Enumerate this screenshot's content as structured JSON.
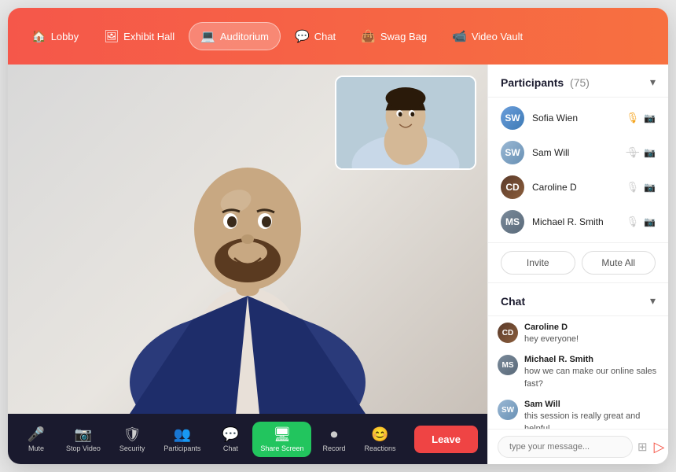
{
  "nav": {
    "items": [
      {
        "id": "lobby",
        "label": "Lobby",
        "icon": "🏠",
        "active": false
      },
      {
        "id": "exhibit-hall",
        "label": "Exhibit Hall",
        "icon": "🖼",
        "active": false
      },
      {
        "id": "auditorium",
        "label": "Auditorium",
        "icon": "💻",
        "active": true
      },
      {
        "id": "chat",
        "label": "Chat",
        "icon": "💬",
        "active": false
      },
      {
        "id": "swag-bag",
        "label": "Swag Bag",
        "icon": "👜",
        "active": false
      },
      {
        "id": "video-vault",
        "label": "Video Vault",
        "icon": "📹",
        "active": false
      }
    ]
  },
  "participants": {
    "title": "Participants",
    "count": "(75)",
    "list": [
      {
        "name": "Sofia Wien",
        "mic": true,
        "cam": true
      },
      {
        "name": "Sam Will",
        "mic": false,
        "cam": false
      },
      {
        "name": "Caroline D",
        "mic": false,
        "cam": false
      },
      {
        "name": "Michael R. Smith",
        "mic": false,
        "cam": false
      }
    ]
  },
  "actions": {
    "invite": "Invite",
    "mute_all": "Mute All"
  },
  "chat": {
    "title": "Chat",
    "messages": [
      {
        "sender": "Caroline D",
        "text": "hey everyone!"
      },
      {
        "sender": "Michael R. Smith",
        "text": "how we can make our online sales fast?"
      },
      {
        "sender": "Sam Will",
        "text": "this session is really great and helpful."
      }
    ],
    "input_placeholder": "type your message..."
  },
  "controls": [
    {
      "id": "mic",
      "label": "Mute",
      "icon": "🎤",
      "active": false
    },
    {
      "id": "video",
      "label": "Stop Video",
      "icon": "📷",
      "active": false
    },
    {
      "id": "security",
      "label": "Security",
      "icon": "🛡",
      "active": false
    },
    {
      "id": "participants",
      "label": "Participants",
      "icon": "👥",
      "active": false
    },
    {
      "id": "chat-ctrl",
      "label": "Chat",
      "icon": "💬",
      "active": false
    },
    {
      "id": "share",
      "label": "Share Screen",
      "icon": "🖥",
      "active": true
    },
    {
      "id": "record",
      "label": "Record",
      "icon": "⏺",
      "active": false
    },
    {
      "id": "reactions",
      "label": "Reactions",
      "icon": "😊",
      "active": false
    }
  ],
  "leave_button": "Leave"
}
